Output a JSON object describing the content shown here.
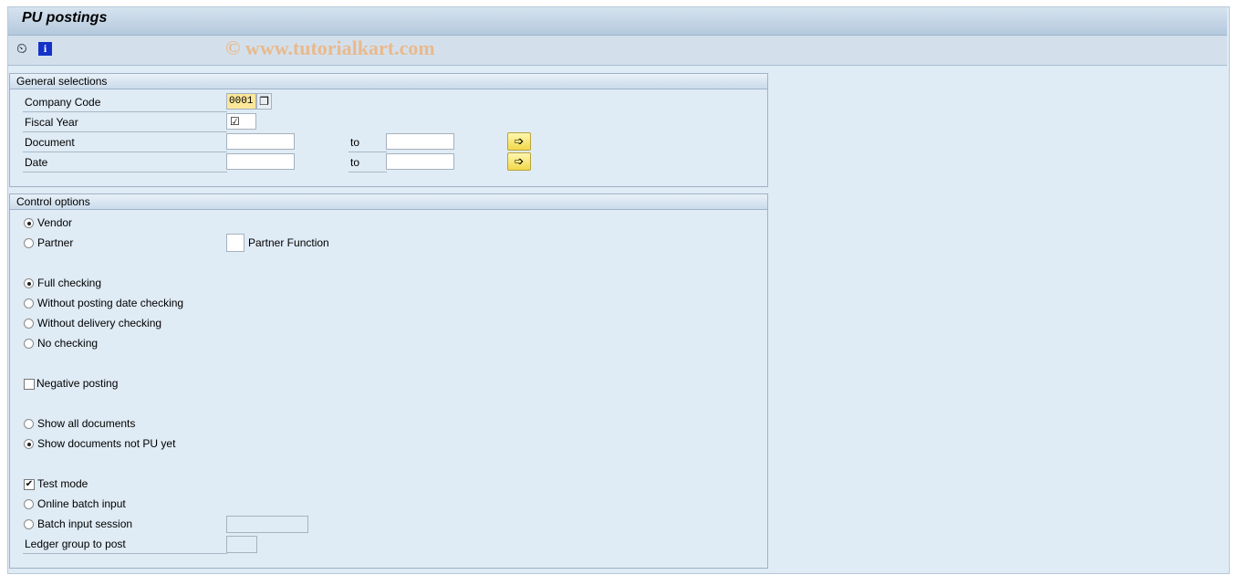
{
  "title": "PU postings",
  "watermark": "© www.tutorialkart.com",
  "toolbar": {
    "execute_icon": "clock-check-icon",
    "info_icon": "info-icon"
  },
  "general": {
    "header": "General selections",
    "company_code": {
      "label": "Company Code",
      "value": "0001"
    },
    "fiscal_year": {
      "label": "Fiscal Year",
      "value": "☑"
    },
    "document": {
      "label": "Document",
      "to": "to",
      "from_value": "",
      "to_value": ""
    },
    "date": {
      "label": "Date",
      "to": "to",
      "from_value": "",
      "to_value": ""
    }
  },
  "control": {
    "header": "Control options",
    "vendor": "Vendor",
    "partner": "Partner",
    "partner_function": "Partner Function",
    "full_checking": "Full checking",
    "without_posting_date": "Without posting date checking",
    "without_delivery": "Without delivery checking",
    "no_checking": "No checking",
    "negative_posting": "Negative posting",
    "show_all": "Show all documents",
    "show_not_pu": "Show documents not PU yet",
    "test_mode": "Test mode",
    "online_batch": "Online batch input",
    "batch_session": "Batch input session",
    "ledger_group": "Ledger group to post",
    "selected": {
      "vendor": true,
      "full_checking": true,
      "show_not_pu": true,
      "test_mode": true,
      "negative_posting": false
    }
  }
}
